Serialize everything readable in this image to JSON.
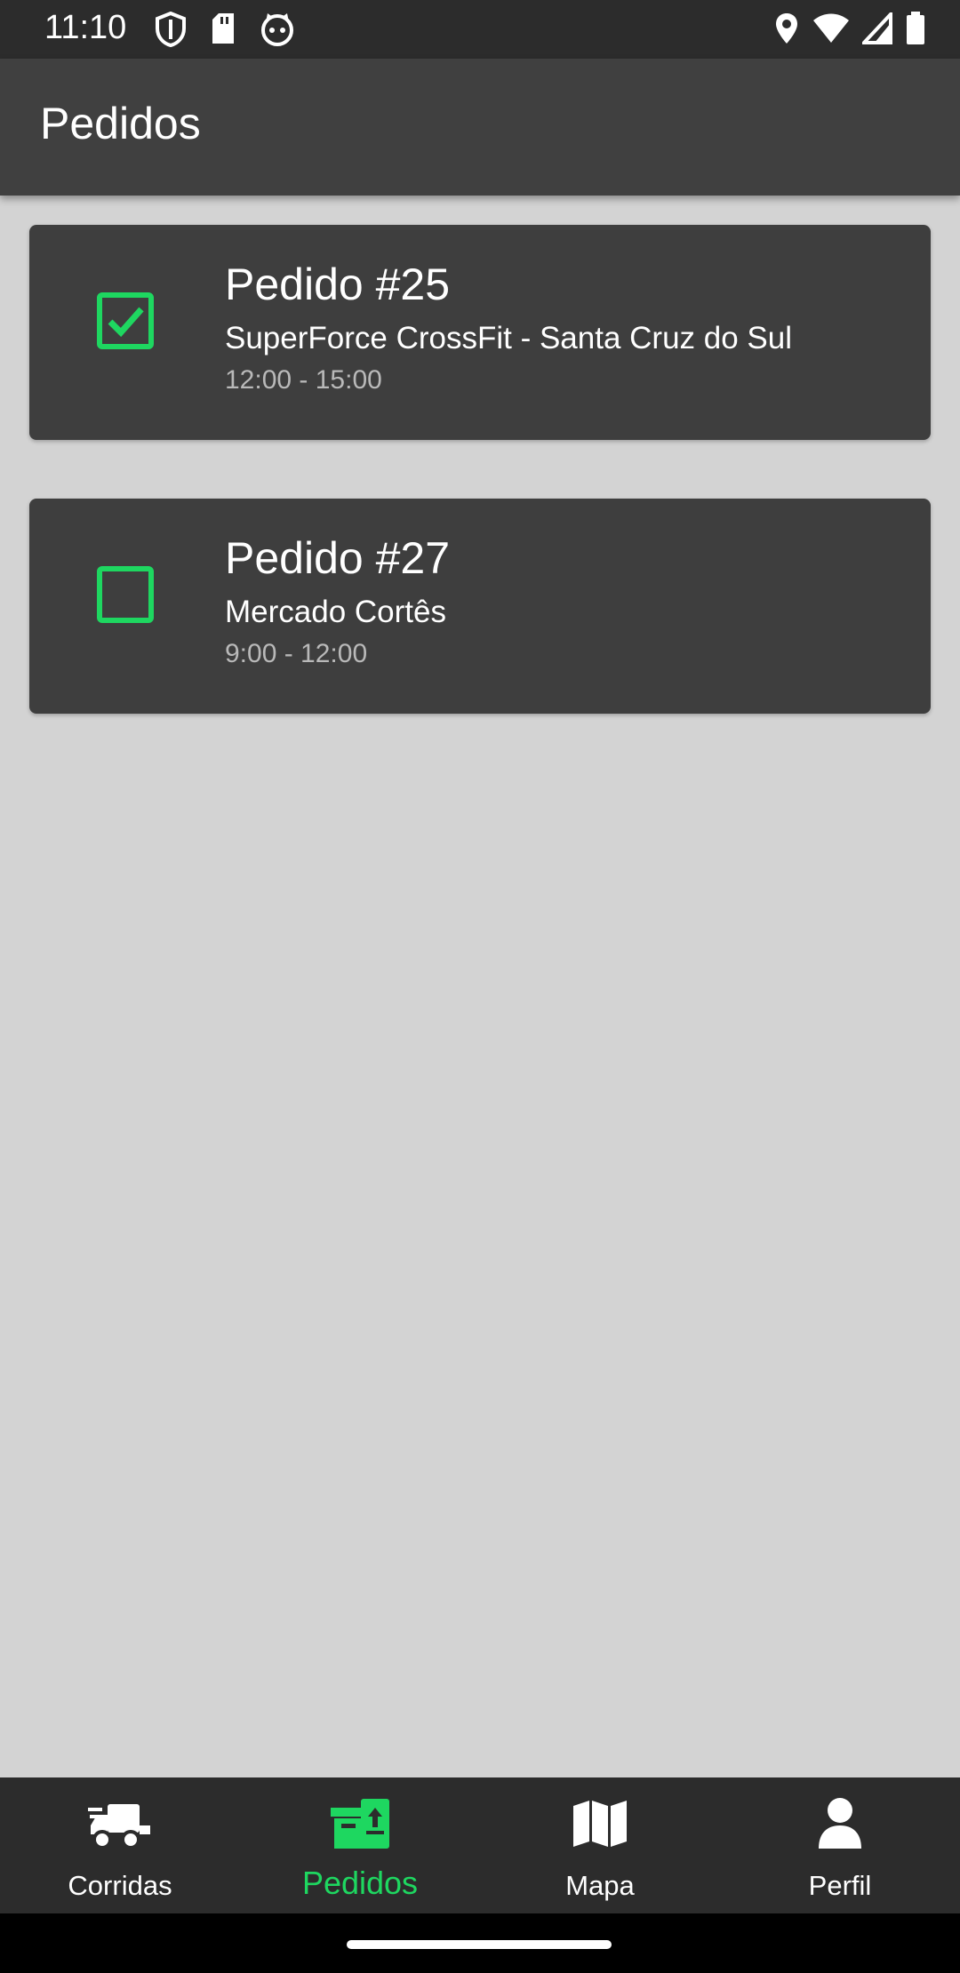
{
  "status_bar": {
    "time": "11:10",
    "icons_left": [
      "shield-icon",
      "sd-card-icon",
      "cat-icon"
    ],
    "icons_right": [
      "location-icon",
      "wifi-icon",
      "signal-icon",
      "battery-icon"
    ]
  },
  "app_bar": {
    "title": "Pedidos"
  },
  "orders": [
    {
      "title": "Pedido #25",
      "place": "SuperForce CrossFit - Santa Cruz do Sul",
      "time": "12:00 - 15:00",
      "checked": true
    },
    {
      "title": "Pedido #27",
      "place": "Mercado Cortês",
      "time": "9:00 - 12:00",
      "checked": false
    }
  ],
  "bottom_nav": {
    "items": [
      {
        "label": "Corridas",
        "icon": "truck-icon",
        "active": false
      },
      {
        "label": "Pedidos",
        "icon": "box-upload-icon",
        "active": true
      },
      {
        "label": "Mapa",
        "icon": "map-icon",
        "active": false
      },
      {
        "label": "Perfil",
        "icon": "user-icon",
        "active": false
      }
    ]
  },
  "colors": {
    "accent": "#1ed760",
    "app_bar": "#404040",
    "card": "#3e3e3e",
    "background": "#d3d3d3",
    "nav_bar": "#2c2c2c"
  }
}
